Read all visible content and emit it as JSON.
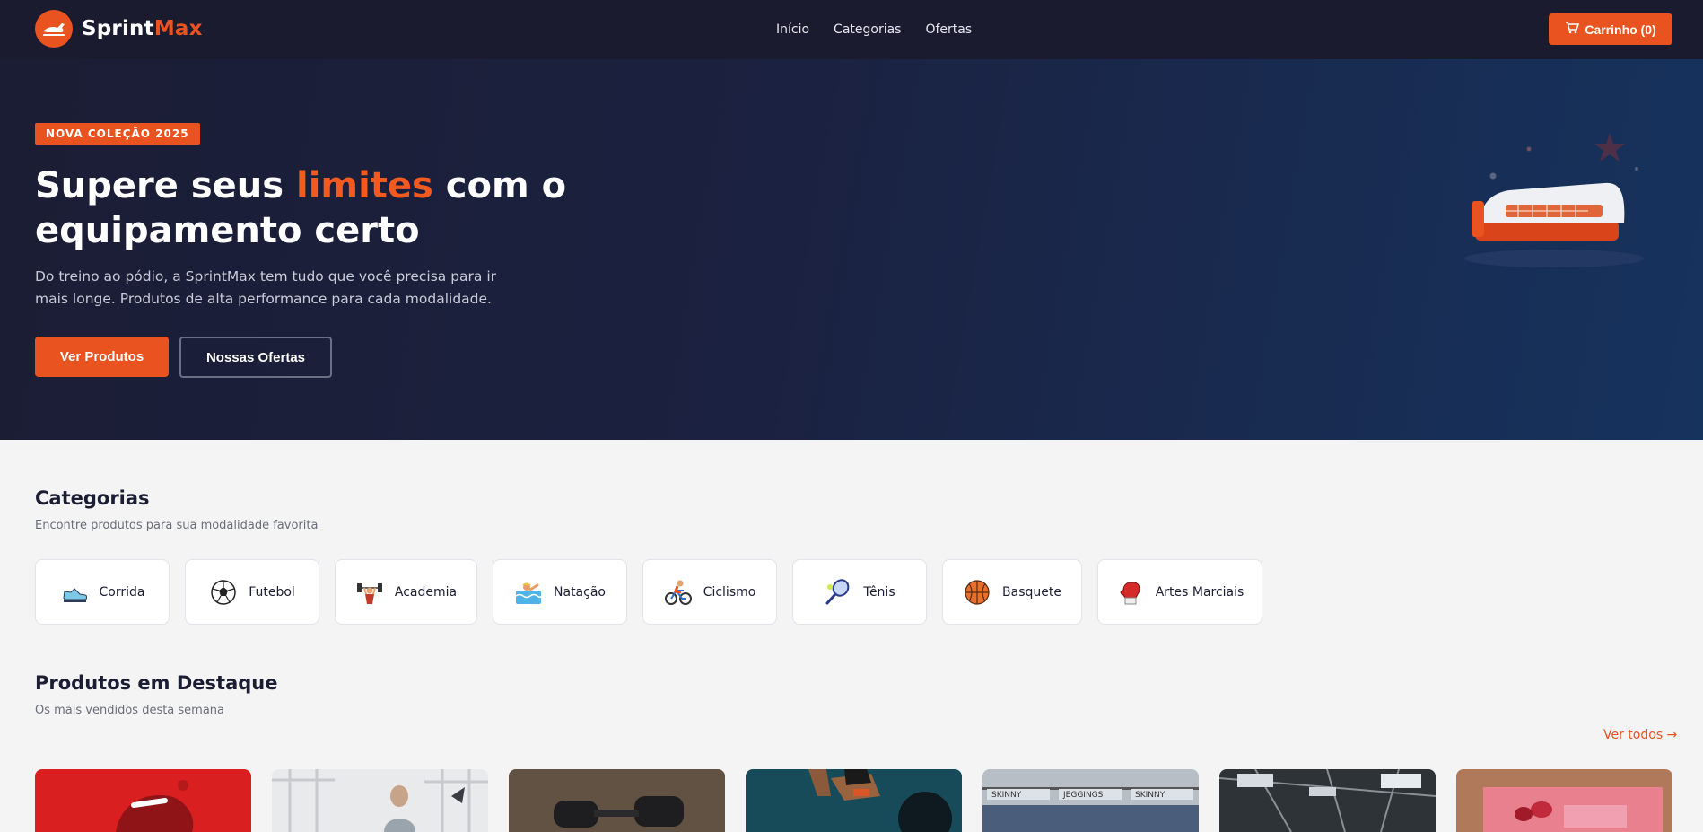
{
  "brand": {
    "name_part1": "Sprint",
    "name_part2": "Max",
    "accent": "#e8531f"
  },
  "nav": {
    "links": [
      {
        "label": "Início"
      },
      {
        "label": "Categorias"
      },
      {
        "label": "Ofertas"
      }
    ],
    "cart_label": "Carrinho (0)"
  },
  "hero": {
    "badge": "NOVA COLEÇÃO 2025",
    "title_before": "Supere seus ",
    "title_highlight": "limites",
    "title_after": " com o equipamento certo",
    "subtitle": "Do treino ao pódio, a SprintMax tem tudo que você precisa para ir mais longe. Produtos de alta performance para cada modalidade.",
    "primary_button": "Ver Produtos",
    "secondary_button": "Nossas Ofertas"
  },
  "categories": {
    "title": "Categorias",
    "subtitle": "Encontre produtos para sua modalidade favorita",
    "items": [
      {
        "label": "Corrida",
        "icon": "running-shoe-icon"
      },
      {
        "label": "Futebol",
        "icon": "soccer-ball-icon"
      },
      {
        "label": "Academia",
        "icon": "weightlifter-icon"
      },
      {
        "label": "Natação",
        "icon": "swimmer-icon"
      },
      {
        "label": "Ciclismo",
        "icon": "cyclist-icon"
      },
      {
        "label": "Tênis",
        "icon": "tennis-racket-icon"
      },
      {
        "label": "Basquete",
        "icon": "basketball-icon"
      },
      {
        "label": "Artes Marciais",
        "icon": "boxing-glove-icon"
      }
    ]
  },
  "featured": {
    "title": "Produtos em Destaque",
    "subtitle": "Os mais vendidos desta semana",
    "see_all": "Ver todos →",
    "products": [
      {
        "image": "red-sneaker-photo"
      },
      {
        "image": "yoga-woman-photo"
      },
      {
        "image": "dumbbells-photo"
      },
      {
        "image": "barbell-athlete-photo"
      },
      {
        "image": "jeans-store-photo"
      },
      {
        "image": "gym-interior-photo"
      },
      {
        "image": "pink-dumbbells-photo"
      }
    ]
  }
}
